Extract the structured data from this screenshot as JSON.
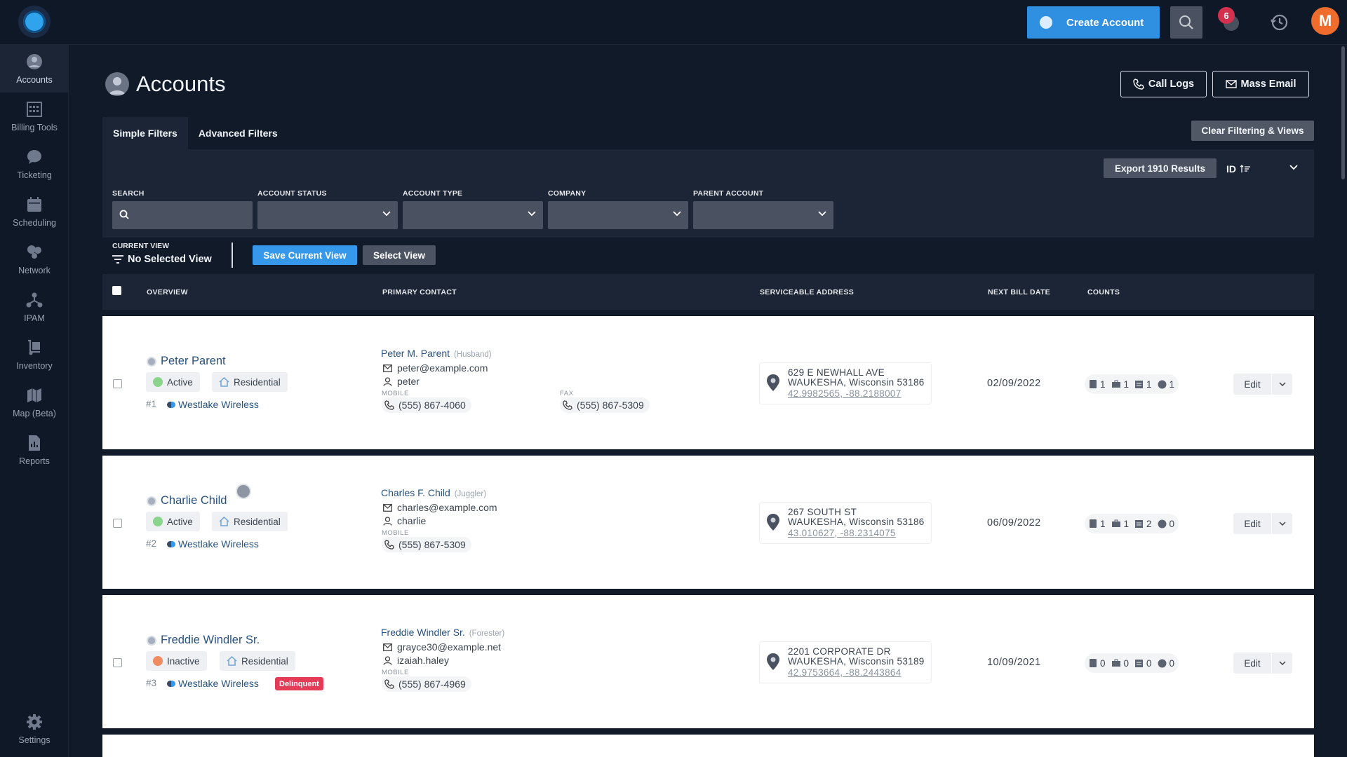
{
  "header": {
    "create_account_label": "Create Account",
    "notification_count": "6",
    "user_initial": "M"
  },
  "sidebar": {
    "items": [
      {
        "label": "Accounts",
        "icon": "person-icon"
      },
      {
        "label": "Billing Tools",
        "icon": "abacus-icon"
      },
      {
        "label": "Ticketing",
        "icon": "chat-bubble-icon"
      },
      {
        "label": "Scheduling",
        "icon": "calendar-icon"
      },
      {
        "label": "Network",
        "icon": "network-icon"
      },
      {
        "label": "IPAM",
        "icon": "ipam-tree-icon"
      },
      {
        "label": "Inventory",
        "icon": "hand-truck-icon"
      },
      {
        "label": "Map (Beta)",
        "icon": "map-icon"
      },
      {
        "label": "Reports",
        "icon": "report-icon"
      }
    ],
    "settings_label": "Settings"
  },
  "page": {
    "title": "Accounts",
    "call_logs_label": "Call Logs",
    "mass_email_label": "Mass Email",
    "clear_label": "Clear Filtering & Views"
  },
  "filters": {
    "tabs": [
      "Simple Filters",
      "Advanced Filters"
    ],
    "export_label": "Export 1910 Results",
    "sort_label": "ID",
    "labels": {
      "search": "SEARCH",
      "status": "ACCOUNT STATUS",
      "type": "ACCOUNT TYPE",
      "company": "COMPANY",
      "parent": "PARENT ACCOUNT"
    }
  },
  "view": {
    "current_label": "CURRENT VIEW",
    "current_value": "No Selected View",
    "save_label": "Save Current View",
    "select_label": "Select View"
  },
  "table": {
    "headers": {
      "overview": "OVERVIEW",
      "contact": "PRIMARY CONTACT",
      "address": "SERVICEABLE ADDRESS",
      "bill": "NEXT BILL DATE",
      "counts": "COUNTS"
    },
    "mobile_label": "MOBILE",
    "fax_label": "FAX",
    "edit_label": "Edit",
    "rows": [
      {
        "name": "Peter Parent",
        "status": "Active",
        "status_color": "#8bd48c",
        "type": "Residential",
        "id": "#1",
        "company": "Westlake Wireless",
        "badge": "",
        "contact_name": "Peter M. Parent",
        "contact_role": "(Husband)",
        "email": "peter@example.com",
        "username": "peter",
        "mobile": "(555) 867-4060",
        "fax": "(555) 867-5309",
        "addr1": "629 E NEWHALL AVE",
        "addr2": "WAUKESHA, Wisconsin 53186",
        "coords": "42.9982565, -88.2188007",
        "bill_date": "02/09/2022",
        "counts": [
          "1",
          "1",
          "1",
          "1"
        ]
      },
      {
        "name": "Charlie Child",
        "status": "Active",
        "status_color": "#8bd48c",
        "type": "Residential",
        "id": "#2",
        "company": "Westlake Wireless",
        "badge": "",
        "contact_name": "Charles F. Child",
        "contact_role": "(Juggler)",
        "email": "charles@example.com",
        "username": "charlie",
        "mobile": "(555) 867-5309",
        "fax": "",
        "addr1": "267 SOUTH ST",
        "addr2": "WAUKESHA, Wisconsin 53186",
        "coords": "43.010627, -88.2314075",
        "bill_date": "06/09/2022",
        "counts": [
          "1",
          "1",
          "2",
          "0"
        ]
      },
      {
        "name": "Freddie Windler Sr.",
        "status": "Inactive",
        "status_color": "#f08b5f",
        "type": "Residential",
        "id": "#3",
        "company": "Westlake Wireless",
        "badge": "Delinquent",
        "contact_name": "Freddie Windler Sr.",
        "contact_role": "(Forester)",
        "email": "grayce30@example.net",
        "username": "izaiah.haley",
        "mobile": "(555) 867-4969",
        "fax": "",
        "addr1": "2201 CORPORATE DR",
        "addr2": "WAUKESHA, Wisconsin 53189",
        "coords": "42.9753664, -88.2443864",
        "bill_date": "10/09/2021",
        "counts": [
          "0",
          "0",
          "0",
          "0"
        ]
      }
    ]
  }
}
